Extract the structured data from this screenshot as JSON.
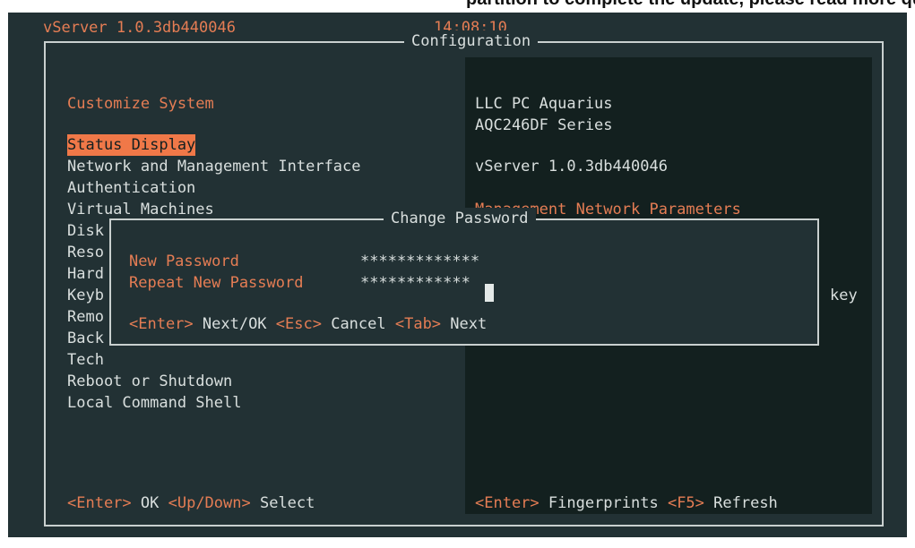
{
  "top_crop_text": "partition to complete the update, please read more quickly",
  "header": {
    "app_version": "vServer 1.0.3db440046",
    "clock": "14:08:10"
  },
  "config": {
    "title": "Configuration"
  },
  "menu": {
    "heading": "Customize System",
    "items": [
      {
        "label": "Status Display",
        "selected": true
      },
      {
        "label": "Network and Management Interface"
      },
      {
        "label": "Authentication"
      },
      {
        "label": "Virtual Machines"
      },
      {
        "label": "Disk"
      },
      {
        "label": "Reso"
      },
      {
        "label": "Hard"
      },
      {
        "label": "Keyb"
      },
      {
        "label": "Remo"
      },
      {
        "label": "Back"
      },
      {
        "label": "Tech"
      },
      {
        "label": "Reboot or Shutdown"
      },
      {
        "label": "Local Command Shell"
      }
    ],
    "footer": {
      "k1": "<Enter>",
      "a1": " OK ",
      "k2": "<Up/Down>",
      "a2": " Select"
    }
  },
  "info": {
    "vendor": "LLC PC Aquarius",
    "model": "AQC246DF Series",
    "version": "vServer 1.0.3db440046",
    "section_heading": "Management Network Parameters",
    "partial_key": "key",
    "footer": {
      "k1": "<Enter>",
      "a1": " Fingerprints ",
      "k2": "<F5>",
      "a2": " Refresh"
    }
  },
  "dialog": {
    "title": "Change Password",
    "new_password_label": "New Password",
    "new_password_value": "*************",
    "repeat_password_label": "Repeat New Password",
    "repeat_password_value": "************",
    "hints": {
      "k1": "<Enter>",
      "a1": " Next/OK ",
      "k2": "<Esc>",
      "a2": " Cancel ",
      "k3": "<Tab>",
      "a3": " Next"
    }
  },
  "colors": {
    "background": "#223134",
    "accent": "#e57d54",
    "text": "#d9dfde",
    "selection": "#f07848"
  }
}
